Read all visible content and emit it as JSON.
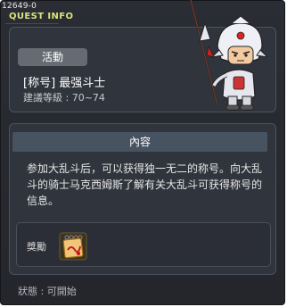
{
  "window": {
    "code": "12649-0",
    "title": "QUEST INFO"
  },
  "quest": {
    "badge": "活動",
    "name": "[称号] 最强斗士",
    "level": "建議等級 : 70~74"
  },
  "content": {
    "header": "內容",
    "description": "参加大乱斗后，可以获得独一无二的称号。向大乱斗的骑士马克西姆斯了解有关大乱斗可获得称号的信息。"
  },
  "reward": {
    "label": "獎勵",
    "icon": "scroll-certificate-icon"
  },
  "status": {
    "text": "狀態 : 可開始"
  },
  "npc": {
    "icon": "armored-knight-npc-icon"
  },
  "colors": {
    "window_bg": "#2b2d34",
    "panel_bg": "#30343c",
    "title_accent": "#d9e37a",
    "content_header_bg": "#485362"
  }
}
